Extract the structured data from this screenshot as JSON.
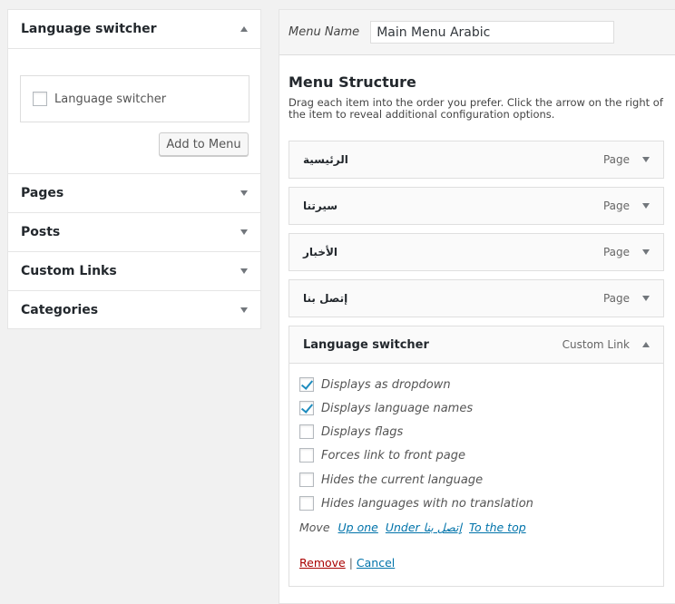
{
  "left": {
    "title": "Language switcher",
    "checkbox_label": "Language switcher",
    "add_button": "Add to Menu",
    "sections": [
      {
        "label": "Pages"
      },
      {
        "label": "Posts"
      },
      {
        "label": "Custom Links"
      },
      {
        "label": "Categories"
      }
    ]
  },
  "right": {
    "menu_name_label": "Menu Name",
    "menu_name_value": "Main Menu Arabic",
    "heading": "Menu Structure",
    "instructions": "Drag each item into the order you prefer. Click the arrow on the right of the item to reveal additional configuration options.",
    "items": [
      {
        "title": "الرئيسية",
        "type": "Page"
      },
      {
        "title": "سيرتنا",
        "type": "Page"
      },
      {
        "title": "الأخبار",
        "type": "Page"
      },
      {
        "title": "إتصل بنا",
        "type": "Page"
      }
    ],
    "expanded": {
      "title": "Language switcher",
      "type": "Custom Link",
      "options": [
        {
          "label": "Displays as dropdown",
          "checked": true
        },
        {
          "label": "Displays language names",
          "checked": true
        },
        {
          "label": "Displays flags",
          "checked": false
        },
        {
          "label": "Forces link to front page",
          "checked": false
        },
        {
          "label": "Hides the current language",
          "checked": false
        },
        {
          "label": "Hides languages with no translation",
          "checked": false
        }
      ],
      "move_label": "Move",
      "move_links": [
        "Up one",
        "Under إتصل بنا",
        "To the top"
      ],
      "remove": "Remove",
      "separator": "|",
      "cancel": "Cancel"
    }
  }
}
